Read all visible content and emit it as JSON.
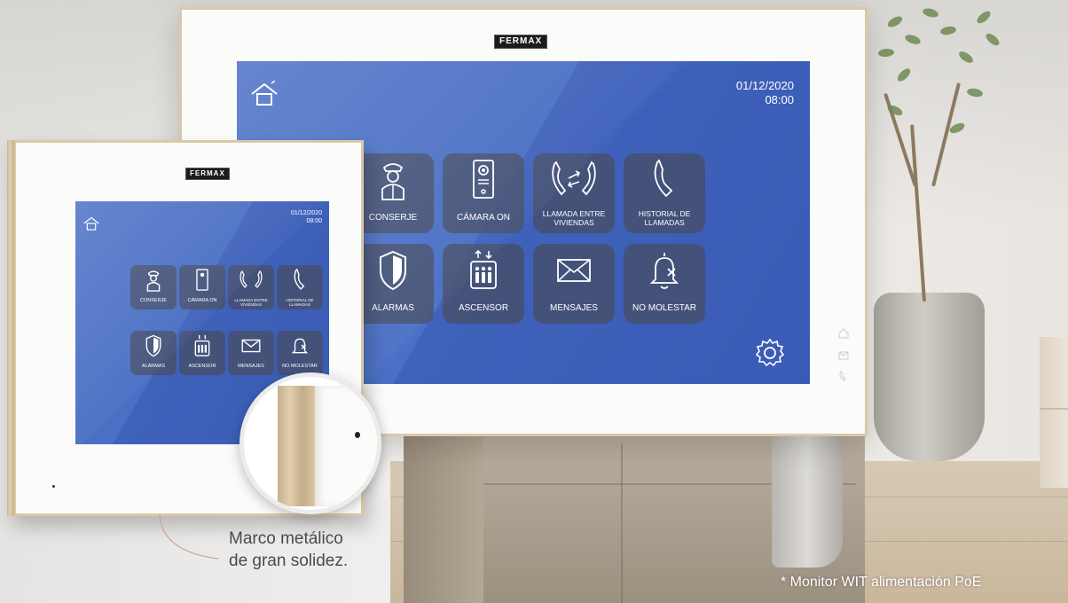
{
  "brand": "FERMAX",
  "screen": {
    "date": "01/12/2020",
    "time": "08:00",
    "tiles": [
      {
        "label": "CONSERJE",
        "icon": "concierge-icon"
      },
      {
        "label": "CÁMARA ON",
        "icon": "camera-panel-icon"
      },
      {
        "label": "LLAMADA ENTRE VIVIENDAS",
        "icon": "intercall-icon"
      },
      {
        "label": "HISTORIAL DE LLAMADAS",
        "icon": "phone-icon"
      },
      {
        "label": "ALARMAS",
        "icon": "shield-icon"
      },
      {
        "label": "ASCENSOR",
        "icon": "elevator-icon"
      },
      {
        "label": "MENSAJES",
        "icon": "envelope-icon"
      },
      {
        "label": "NO MOLESTAR",
        "icon": "bell-muted-icon"
      }
    ],
    "small_tiles": [
      {
        "label": "CONSERJE"
      },
      {
        "label": "CÁMARA ON"
      },
      {
        "label": "LLAMADA ENTRE VIVIENDAS"
      },
      {
        "label": "HISTORIAL DE LLAMADAS"
      },
      {
        "label": "ALARMAS"
      },
      {
        "label": "ASCENSOR"
      },
      {
        "label": "MENSAJES"
      },
      {
        "label": "NO MOLESTAR"
      }
    ]
  },
  "caption": {
    "title": "Marco metálico",
    "subtitle": "de gran solidez."
  },
  "footnote": "* Monitor WIT alimentación PoE",
  "colors": {
    "screen_blue": "#4a6fc4",
    "tile_bg": "#464e68",
    "frame_wood": "#d9c8a9",
    "callout_line": "#c9a48a"
  }
}
